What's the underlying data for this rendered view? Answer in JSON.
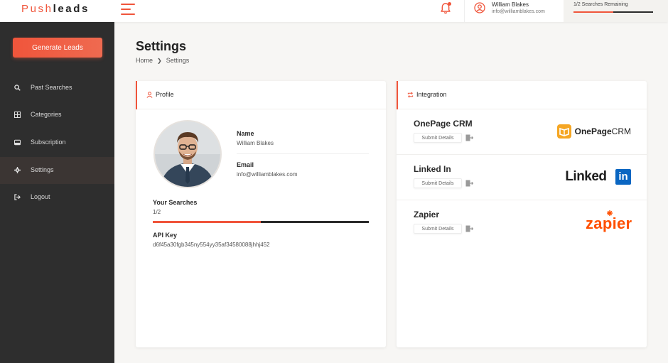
{
  "brand": {
    "name_part1": "Push",
    "name_part2": "leads",
    "accent": "#f0553b"
  },
  "topbar": {
    "user_name": "William Blakes",
    "user_email": "info@williamblakes.com",
    "searches_remaining": "1/2 Searches Remaining",
    "searches_progress": 0.5,
    "icons": [
      "hamburger-menu-icon",
      "bell-icon",
      "user-circle-icon"
    ]
  },
  "sidebar": {
    "generate_button": "Generate Leads",
    "items": [
      {
        "label": "Past Searches",
        "icon": "search-icon"
      },
      {
        "label": "Categories",
        "icon": "grid-icon"
      },
      {
        "label": "Subscription",
        "icon": "card-icon"
      },
      {
        "label": "Settings",
        "icon": "gear-icon",
        "active": true
      },
      {
        "label": "Logout",
        "icon": "logout-icon"
      }
    ]
  },
  "page": {
    "title": "Settings",
    "breadcrumb": {
      "home": "Home",
      "current": "Settings"
    }
  },
  "profile": {
    "header": "Profile",
    "name_label": "Name",
    "name_value": "William Blakes",
    "email_label": "Email",
    "email_value": "info@williamblakes.com",
    "searches_label": "Your Searches",
    "searches_value": "1/2",
    "searches_progress": 0.5,
    "api_key_label": "API Key",
    "api_key_value": "d6f45a30fgb345ny554yy35af34580088jhhj452"
  },
  "integration": {
    "header": "Integration",
    "items": [
      {
        "name": "OnePage CRM",
        "button": "Submit Details",
        "logo_text_bold": "OnePage",
        "logo_text_light": "CRM"
      },
      {
        "name": "Linked In",
        "button": "Submit Details",
        "logo_text": "Linked",
        "logo_badge": "in"
      },
      {
        "name": "Zapier",
        "button": "Submit Details",
        "logo_text": "zapier"
      }
    ]
  }
}
